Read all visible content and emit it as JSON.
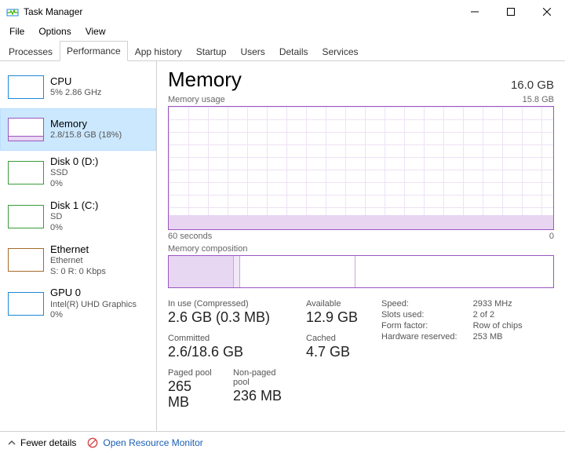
{
  "window": {
    "title": "Task Manager",
    "controls": {
      "minimize": "–",
      "maximize": "☐",
      "close": "✕"
    }
  },
  "menu": {
    "file": "File",
    "options": "Options",
    "view": "View"
  },
  "tabs": {
    "processes": "Processes",
    "performance": "Performance",
    "appHistory": "App history",
    "startup": "Startup",
    "users": "Users",
    "details": "Details",
    "services": "Services"
  },
  "sidebar": {
    "cpu": {
      "title": "CPU",
      "sub": "5%  2.86 GHz"
    },
    "memory": {
      "title": "Memory",
      "sub": "2.8/15.8 GB (18%)"
    },
    "disk0": {
      "title": "Disk 0 (D:)",
      "sub1": "SSD",
      "sub2": "0%"
    },
    "disk1": {
      "title": "Disk 1 (C:)",
      "sub1": "SD",
      "sub2": "0%"
    },
    "ethernet": {
      "title": "Ethernet",
      "sub1": "Ethernet",
      "sub2": "S: 0 R: 0 Kbps"
    },
    "gpu": {
      "title": "GPU 0",
      "sub1": "Intel(R) UHD Graphics",
      "sub2": "0%"
    }
  },
  "main": {
    "title": "Memory",
    "total": "16.0 GB",
    "usageLabel": "Memory usage",
    "usageMax": "15.8 GB",
    "timeLeft": "60 seconds",
    "timeRight": "0",
    "compTitle": "Memory composition"
  },
  "composition": {
    "segments": [
      {
        "cls": "seg-inuse",
        "percent": 17
      },
      {
        "cls": "seg-mod",
        "percent": 1.5
      },
      {
        "cls": "seg-standby",
        "percent": 30
      },
      {
        "cls": "seg-free",
        "percent": 51.5
      }
    ]
  },
  "stats": {
    "inUseLabel": "In use (Compressed)",
    "inUseValue": "2.6 GB (0.3 MB)",
    "availableLabel": "Available",
    "availableValue": "12.9 GB",
    "committedLabel": "Committed",
    "committedValue": "2.6/18.6 GB",
    "cachedLabel": "Cached",
    "cachedValue": "4.7 GB",
    "pagedLabel": "Paged pool",
    "pagedValue": "265 MB",
    "nonPagedLabel": "Non-paged pool",
    "nonPagedValue": "236 MB"
  },
  "info": {
    "speedLabel": "Speed:",
    "speedValue": "2933 MHz",
    "slotsLabel": "Slots used:",
    "slotsValue": "2 of 2",
    "formLabel": "Form factor:",
    "formValue": "Row of chips",
    "hwResLabel": "Hardware reserved:",
    "hwResValue": "253 MB"
  },
  "statusbar": {
    "fewerDetails": "Fewer details",
    "openResourceMonitor": "Open Resource Monitor"
  }
}
